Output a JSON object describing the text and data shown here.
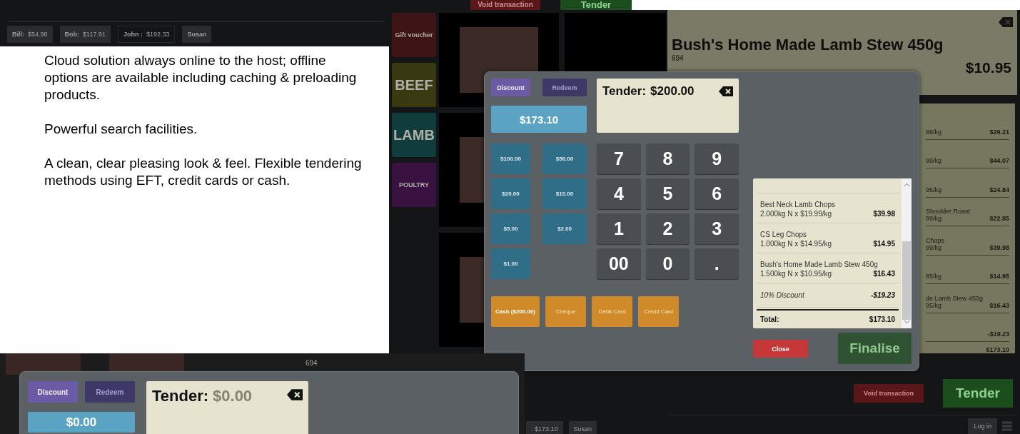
{
  "top_strip": {
    "buttons": [
      {
        "kind": "void",
        "label": "Void transaction"
      },
      {
        "kind": "tender",
        "label": "Tender"
      }
    ],
    "customer_tabs": [
      {
        "name": "Bill:",
        "amount": "$54.98",
        "selected": false
      },
      {
        "name": "Bob:",
        "amount": "$117.91",
        "selected": false
      },
      {
        "name": "John :",
        "amount": "$192.33",
        "selected": true
      },
      {
        "name": "Susan",
        "selected": false
      }
    ]
  },
  "background_screen": {
    "categories": [
      {
        "label": "Gift voucher",
        "color": "#3e1417"
      },
      {
        "label": "BEEF",
        "color": "#3a3a12"
      },
      {
        "label": "LAMB",
        "color": "#103c3c"
      },
      {
        "label": "POULTRY",
        "color": "#3a1242"
      }
    ],
    "product": {
      "title": "Bush's Home Made Lamb Stew 450g",
      "code": "694",
      "price": "$10.95"
    },
    "order_lines": [
      {
        "detail": "99/kg",
        "amount": "$29.21"
      },
      {
        "detail": "99/kg",
        "amount": "$44.07"
      },
      {
        "detail": "95/kg",
        "amount": "$24.84"
      },
      {
        "name": "Shoulder Roast",
        "detail": "99/kg",
        "amount": "$22.85"
      },
      {
        "name": "Chops",
        "detail": "99/kg",
        "amount": "$39.98"
      },
      {
        "detail": "95/kg",
        "amount": "$14.95"
      },
      {
        "name": "de Lamb Stew 450g",
        "detail": "95/kg",
        "amount": "$16.43"
      },
      {
        "amount": "-$19.23"
      }
    ],
    "total": "$173.10",
    "void_button": "Void transaction",
    "tender_button": "Tender",
    "customer_tabs": [
      {
        "name": ": $173.10"
      },
      {
        "name": "Susan"
      }
    ],
    "login_button": "Log in"
  },
  "description": [
    "Cloud solution always online to the host; offline options are available including caching & preloading products.",
    "Powerful search facilities.",
    "A clean, clear pleasing look & feel. Flexible tendering methods using EFT, credit cards or cash."
  ],
  "tender_dialog": {
    "actions": [
      {
        "label": "Discount",
        "disabled": false
      },
      {
        "label": "Redeem",
        "disabled": true
      }
    ],
    "amount_due": "$173.10",
    "tender_label": "Tender:",
    "tender_value": "$200.00",
    "quick_cash": [
      "$100.00",
      "$50.00",
      "$20.00",
      "$10.00",
      "$5.00",
      "$2.00",
      "$1.00"
    ],
    "keypad": [
      "7",
      "8",
      "9",
      "4",
      "5",
      "6",
      "1",
      "2",
      "3",
      "00",
      "0",
      "."
    ],
    "payment_methods": [
      {
        "label": "Cash ($200.00)",
        "disabled": false
      },
      {
        "label": "Cheque",
        "disabled": true
      },
      {
        "label": "Debit Card",
        "disabled": true
      },
      {
        "label": "Credit Card",
        "disabled": true
      }
    ],
    "receipt": [
      {
        "kind": "item",
        "name": "Best Neck Lamb Chops",
        "detail": "2.000kg N x $19.99/kg",
        "amount": "$39.98"
      },
      {
        "kind": "item",
        "name": "CS Leg Chops",
        "detail": "1.000kg N x $14.95/kg",
        "amount": "$14.95"
      },
      {
        "kind": "item",
        "name": "Bush's Home Made Lamb Stew 450g",
        "detail": "1.500kg N x $10.95/kg",
        "amount": "$16.43"
      },
      {
        "kind": "discount",
        "name": "10% Discount",
        "amount": "-$19.23"
      },
      {
        "kind": "total",
        "name": "Total:",
        "amount": "$173.10"
      }
    ],
    "close_button": "Close",
    "finalise_button": "Finalise",
    "finalise_disabled": true
  },
  "second_dialog": {
    "product_code": "694",
    "actions": [
      {
        "label": "Discount",
        "disabled": false
      },
      {
        "label": "Redeem",
        "disabled": true
      }
    ],
    "tender_label": "Tender:",
    "tender_placeholder": "$0.00",
    "amount_due": "$0.00"
  }
}
